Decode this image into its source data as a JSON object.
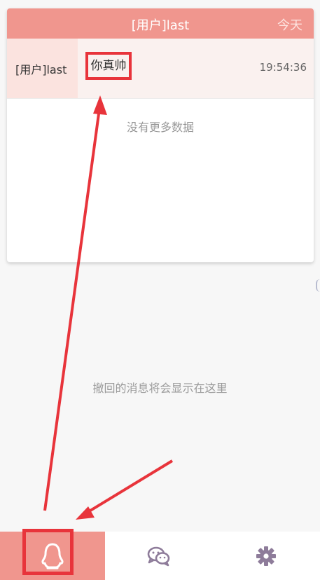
{
  "card": {
    "title": "[用户]last",
    "date_label": "今天",
    "message": {
      "sender": "[用户]last",
      "content": "你真帅",
      "time": "19:54:36"
    },
    "no_more_text": "没有更多数据"
  },
  "empty_hint": "撤回的消息将会显示在这里",
  "tabs": [
    {
      "name": "qq",
      "icon": "qq-penguin-icon",
      "active": true
    },
    {
      "name": "wechat",
      "icon": "wechat-icon",
      "active": false
    },
    {
      "name": "settings",
      "icon": "gear-icon",
      "active": false
    }
  ],
  "colors": {
    "accent": "#f0968e",
    "annotation_red": "#e8343b",
    "icon_purple": "#8e7c9a"
  }
}
